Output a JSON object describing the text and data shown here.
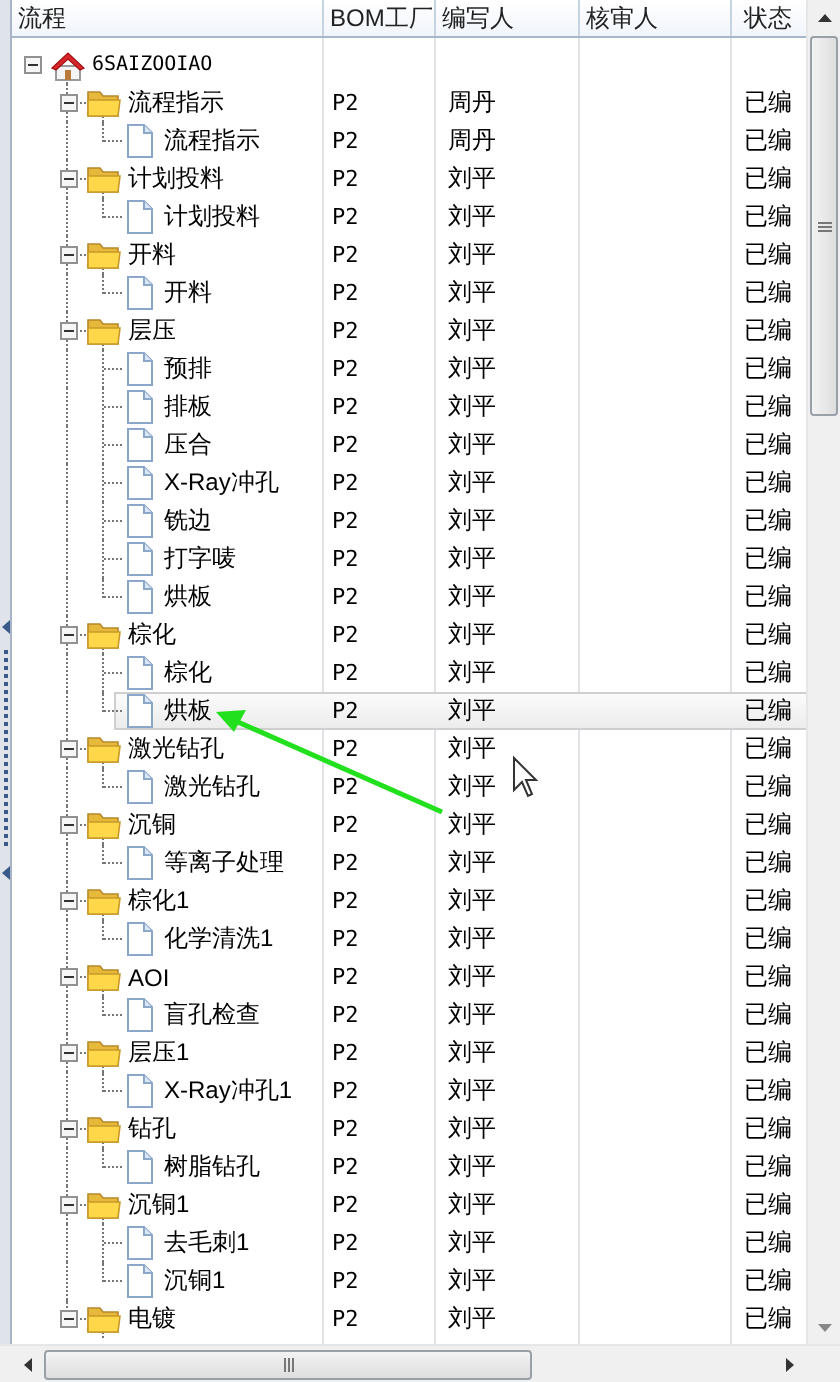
{
  "table": {
    "columns": [
      "流程",
      "BOM工厂",
      "编写人",
      "核审人",
      "状态"
    ],
    "tree": {
      "name": "6SAIZOOIAO",
      "kind": "root",
      "expanded": true,
      "selected": false,
      "children": [
        {
          "name": "流程指示",
          "kind": "folder",
          "expanded": true,
          "selected": false,
          "bom": "P2",
          "writer": "周丹",
          "status": "已编",
          "children": [
            {
              "name": "流程指示",
              "kind": "doc",
              "selected": false,
              "bom": "P2",
              "writer": "周丹",
              "status": "已编"
            }
          ]
        },
        {
          "name": "计划投料",
          "kind": "folder",
          "expanded": true,
          "selected": false,
          "bom": "P2",
          "writer": "刘平",
          "status": "已编",
          "children": [
            {
              "name": "计划投料",
              "kind": "doc",
              "selected": false,
              "bom": "P2",
              "writer": "刘平",
              "status": "已编"
            }
          ]
        },
        {
          "name": "开料",
          "kind": "folder",
          "expanded": true,
          "selected": false,
          "bom": "P2",
          "writer": "刘平",
          "status": "已编",
          "children": [
            {
              "name": "开料",
              "kind": "doc",
              "selected": false,
              "bom": "P2",
              "writer": "刘平",
              "status": "已编"
            }
          ]
        },
        {
          "name": "层压",
          "kind": "folder",
          "expanded": true,
          "selected": false,
          "bom": "P2",
          "writer": "刘平",
          "status": "已编",
          "children": [
            {
              "name": "预排",
              "kind": "doc",
              "selected": false,
              "bom": "P2",
              "writer": "刘平",
              "status": "已编"
            },
            {
              "name": "排板",
              "kind": "doc",
              "selected": false,
              "bom": "P2",
              "writer": "刘平",
              "status": "已编"
            },
            {
              "name": "压合",
              "kind": "doc",
              "selected": false,
              "bom": "P2",
              "writer": "刘平",
              "status": "已编"
            },
            {
              "name": "X-Ray冲孔",
              "kind": "doc",
              "selected": false,
              "bom": "P2",
              "writer": "刘平",
              "status": "已编"
            },
            {
              "name": "铣边",
              "kind": "doc",
              "selected": false,
              "bom": "P2",
              "writer": "刘平",
              "status": "已编"
            },
            {
              "name": "打字唛",
              "kind": "doc",
              "selected": false,
              "bom": "P2",
              "writer": "刘平",
              "status": "已编"
            },
            {
              "name": "烘板",
              "kind": "doc",
              "selected": false,
              "bom": "P2",
              "writer": "刘平",
              "status": "已编"
            }
          ]
        },
        {
          "name": "棕化",
          "kind": "folder",
          "expanded": true,
          "selected": false,
          "bom": "P2",
          "writer": "刘平",
          "status": "已编",
          "children": [
            {
              "name": "棕化",
              "kind": "doc",
              "selected": false,
              "bom": "P2",
              "writer": "刘平",
              "status": "已编"
            },
            {
              "name": "烘板",
              "kind": "doc",
              "selected": true,
              "bom": "P2",
              "writer": "刘平",
              "status": "已编"
            }
          ]
        },
        {
          "name": "激光钻孔",
          "kind": "folder",
          "expanded": true,
          "selected": false,
          "bom": "P2",
          "writer": "刘平",
          "status": "已编",
          "children": [
            {
              "name": "激光钻孔",
              "kind": "doc",
              "selected": false,
              "bom": "P2",
              "writer": "刘平",
              "status": "已编"
            }
          ]
        },
        {
          "name": "沉铜",
          "kind": "folder",
          "expanded": true,
          "selected": false,
          "bom": "P2",
          "writer": "刘平",
          "status": "已编",
          "children": [
            {
              "name": "等离子处理",
              "kind": "doc",
              "selected": false,
              "bom": "P2",
              "writer": "刘平",
              "status": "已编"
            }
          ]
        },
        {
          "name": "棕化1",
          "kind": "folder",
          "expanded": true,
          "selected": false,
          "bom": "P2",
          "writer": "刘平",
          "status": "已编",
          "children": [
            {
              "name": "化学清洗1",
              "kind": "doc",
              "selected": false,
              "bom": "P2",
              "writer": "刘平",
              "status": "已编"
            }
          ]
        },
        {
          "name": "AOI",
          "kind": "folder",
          "expanded": true,
          "selected": false,
          "bom": "P2",
          "writer": "刘平",
          "status": "已编",
          "children": [
            {
              "name": "盲孔检查",
              "kind": "doc",
              "selected": false,
              "bom": "P2",
              "writer": "刘平",
              "status": "已编"
            }
          ]
        },
        {
          "name": "层压1",
          "kind": "folder",
          "expanded": true,
          "selected": false,
          "bom": "P2",
          "writer": "刘平",
          "status": "已编",
          "children": [
            {
              "name": "X-Ray冲孔1",
              "kind": "doc",
              "selected": false,
              "bom": "P2",
              "writer": "刘平",
              "status": "已编"
            }
          ]
        },
        {
          "name": "钻孔",
          "kind": "folder",
          "expanded": true,
          "selected": false,
          "bom": "P2",
          "writer": "刘平",
          "status": "已编",
          "children": [
            {
              "name": "树脂钻孔",
              "kind": "doc",
              "selected": false,
              "bom": "P2",
              "writer": "刘平",
              "status": "已编"
            }
          ]
        },
        {
          "name": "沉铜1",
          "kind": "folder",
          "expanded": true,
          "selected": false,
          "bom": "P2",
          "writer": "刘平",
          "status": "已编",
          "children": [
            {
              "name": "去毛刺1",
              "kind": "doc",
              "selected": false,
              "bom": "P2",
              "writer": "刘平",
              "status": "已编"
            },
            {
              "name": "沉铜1",
              "kind": "doc",
              "selected": false,
              "bom": "P2",
              "writer": "刘平",
              "status": "已编"
            }
          ]
        },
        {
          "name": "电镀",
          "kind": "folder",
          "expanded": true,
          "selected": false,
          "bom": "P2",
          "writer": "刘平",
          "status": "已编"
        }
      ]
    }
  }
}
